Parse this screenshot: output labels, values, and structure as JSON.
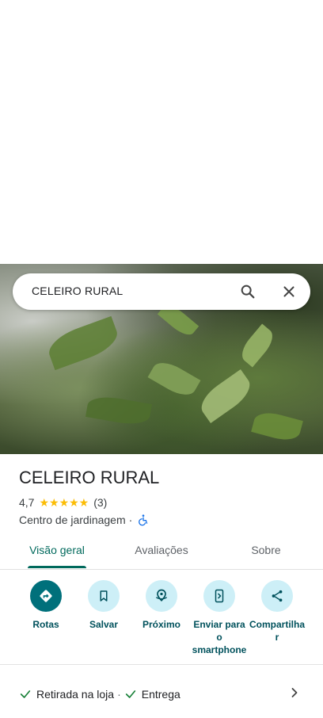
{
  "search": {
    "query": "CELEIRO RURAL"
  },
  "place": {
    "title": "CELEIRO RURAL",
    "rating": "4,7",
    "stars": "★★★★★",
    "review_count": "(3)",
    "category": "Centro de jardinagem",
    "category_separator": "·"
  },
  "tabs": [
    {
      "label": "Visão geral",
      "active": true
    },
    {
      "label": "Avaliações",
      "active": false
    },
    {
      "label": "Sobre",
      "active": false
    }
  ],
  "actions": [
    {
      "label": "Rotas",
      "icon": "directions-icon"
    },
    {
      "label": "Salvar",
      "icon": "bookmark-icon"
    },
    {
      "label": "Próximo",
      "icon": "nearby-icon"
    },
    {
      "label": "Enviar para o smartphone",
      "icon": "send-to-phone-icon"
    },
    {
      "label": "Compartilhar",
      "icon": "share-icon"
    }
  ],
  "amenities": [
    {
      "label": "Retirada na loja"
    },
    {
      "label": "Entrega"
    }
  ],
  "amenities_separator": "·",
  "colors": {
    "accent": "#00695c",
    "primary_button": "#00707b",
    "chip_bg": "#cdeff7",
    "star": "#fbbc04"
  }
}
